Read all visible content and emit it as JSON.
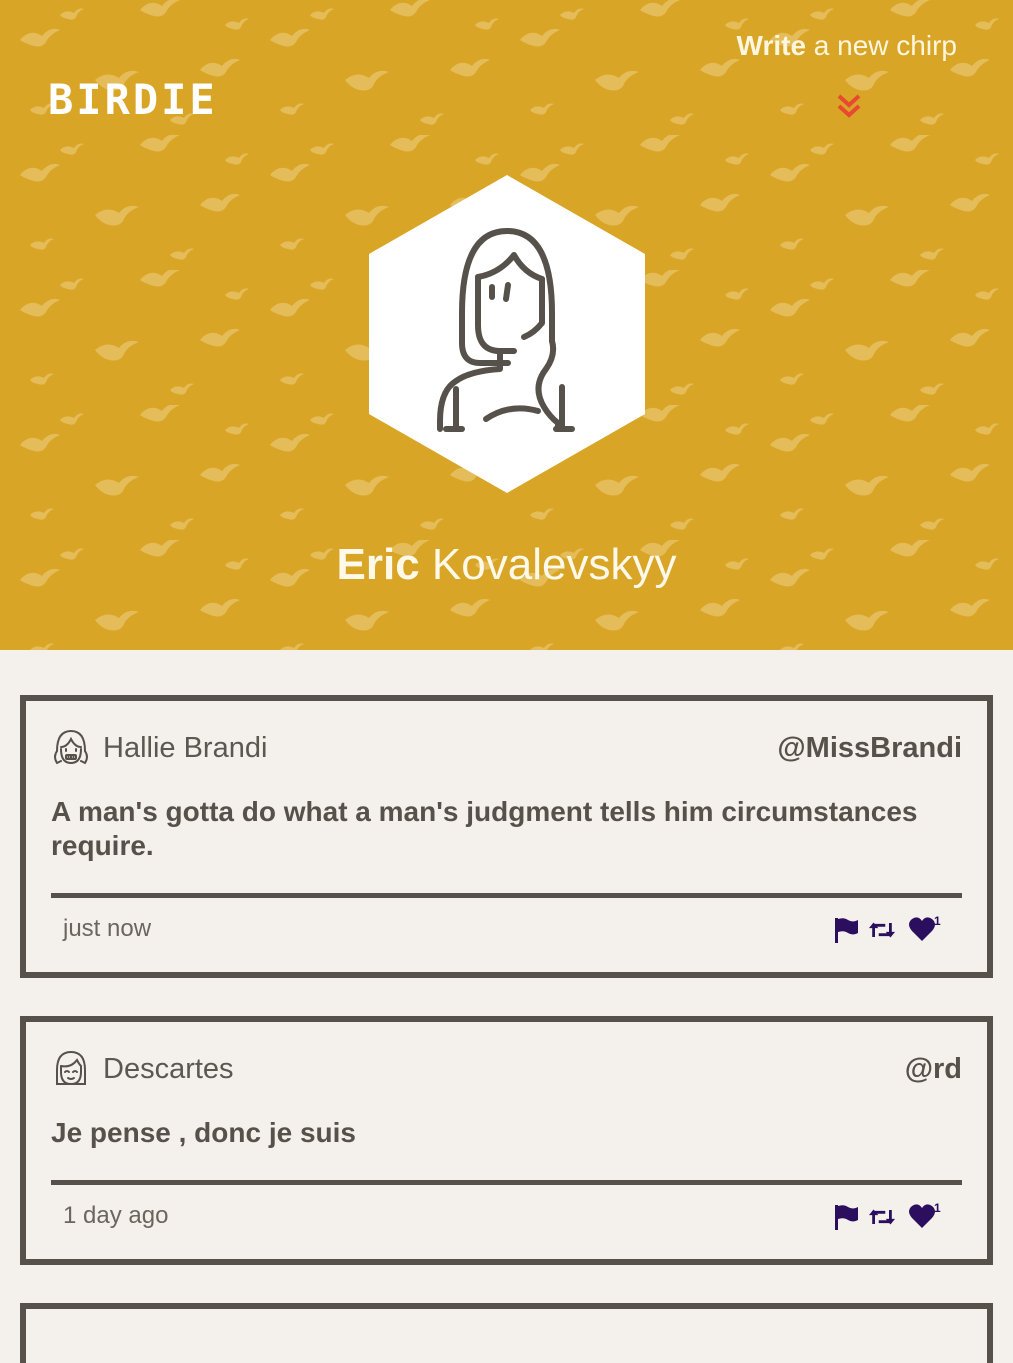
{
  "brand": {
    "logo": "BIRDIE",
    "header_color": "#d9a526",
    "accent_color": "#e8492f",
    "action_color": "#2b0f5e"
  },
  "nav": {
    "write_strong": "Write",
    "write_rest": " a new chirp",
    "scroll_icon": "double-chevron-down-icon"
  },
  "profile": {
    "first_name": "Eric",
    "last_name": "Kovalevskyy",
    "avatar_icon": "woman-avatar-icon"
  },
  "chirps": [
    {
      "author": "Hallie Brandi",
      "handle": "@MissBrandi",
      "message": "A man's gotta do what a man's judgment tells him circumstances require.",
      "time": "just now",
      "likes": "1",
      "avatar_icon": "girl-avatar-icon"
    },
    {
      "author": "Descartes",
      "handle": "@rd",
      "message": "Je pense , donc je suis",
      "time": "1 day ago",
      "likes": "1",
      "avatar_icon": "girl-avatar-icon"
    }
  ]
}
